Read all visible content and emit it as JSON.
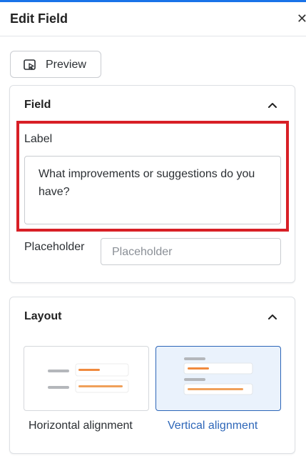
{
  "header": {
    "title": "Edit Field"
  },
  "toolbar": {
    "preview_label": "Preview"
  },
  "field_section": {
    "title": "Field",
    "label_caption": "Label",
    "label_value": "What improvements or suggestions do you have?",
    "placeholder_caption": "Placeholder",
    "placeholder_hint": "Placeholder"
  },
  "layout_section": {
    "title": "Layout",
    "options": [
      {
        "label": "Horizontal alignment",
        "selected": false
      },
      {
        "label": "Vertical alignment",
        "selected": true
      }
    ]
  },
  "colors": {
    "accent": "#1a73e8",
    "highlight": "#d81f26",
    "selected": "#2d66b8",
    "preview_line_orange": "#f08a3e"
  }
}
